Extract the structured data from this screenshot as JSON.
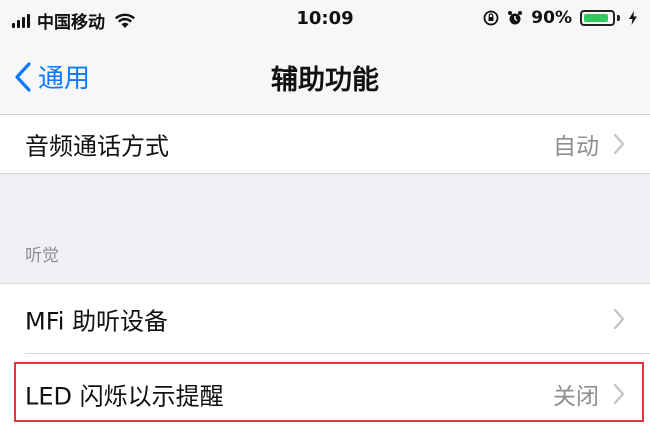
{
  "status_bar": {
    "carrier": "中国移动",
    "time": "10:09",
    "battery_percent_text": "90%",
    "battery_level": 0.9,
    "colors": {
      "battery": "#33c85a"
    }
  },
  "nav": {
    "back_label": "通用",
    "title": "辅助功能",
    "colors": {
      "accent": "#0a7aff"
    }
  },
  "rows": {
    "audio_call": {
      "label": "音频通话方式",
      "value": "自动"
    },
    "hearing_section": {
      "header": "听觉"
    },
    "mfi": {
      "label": "MFi 助听设备"
    },
    "led": {
      "label": "LED 闪烁以示提醒",
      "value": "关闭"
    }
  },
  "highlight": {
    "color": "#e0353c"
  }
}
